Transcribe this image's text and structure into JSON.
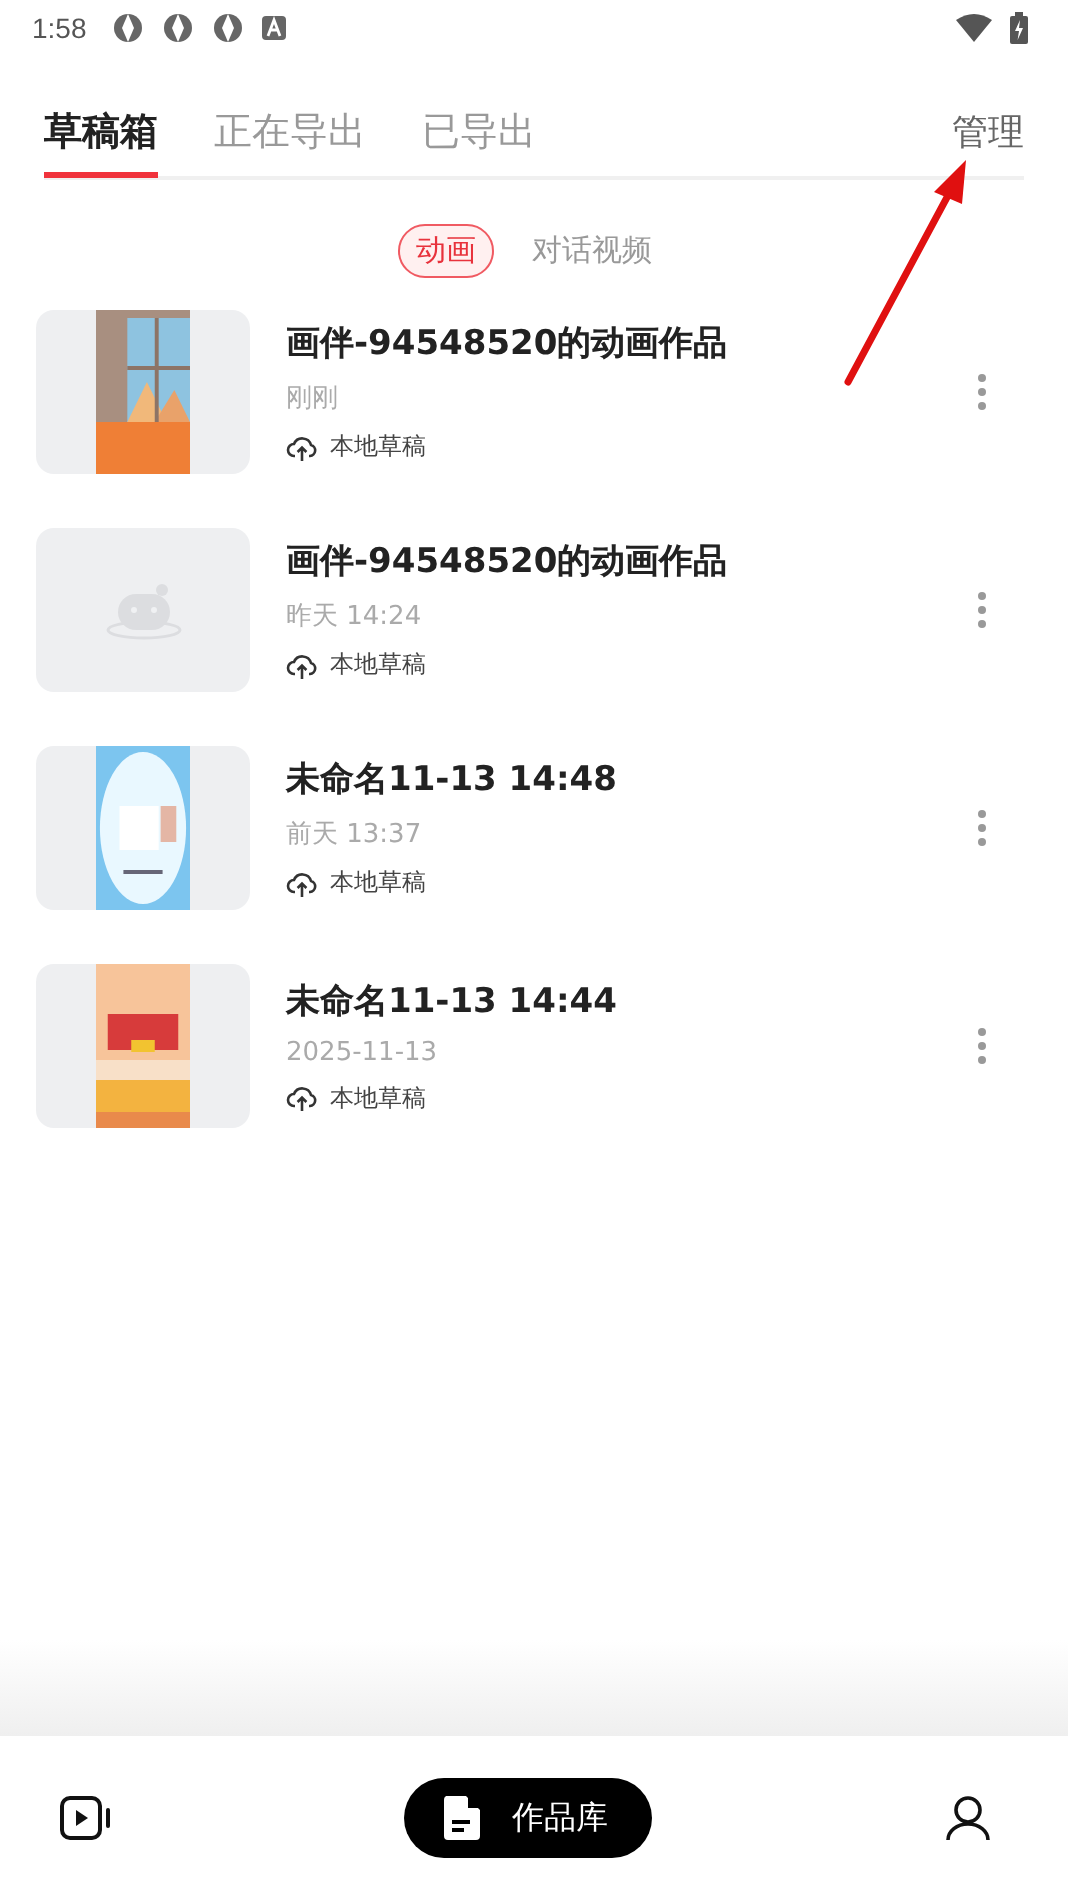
{
  "status_bar": {
    "time": "1:58"
  },
  "tabs": [
    {
      "label": "草稿箱",
      "selected": true
    },
    {
      "label": "正在导出",
      "selected": false
    },
    {
      "label": "已导出",
      "selected": false
    }
  ],
  "manage_button": "管理",
  "filters": [
    {
      "label": "动画",
      "selected": true
    },
    {
      "label": "对话视频",
      "selected": false
    }
  ],
  "drafts": [
    {
      "title": "画伴-94548520的动画作品",
      "time": "刚刚",
      "storage": "本地草稿"
    },
    {
      "title": "画伴-94548520的动画作品",
      "time": "昨天 14:24",
      "storage": "本地草稿",
      "thumb": {
        "kind": "placeholder"
      }
    },
    {
      "title": "未命名11-13 14:48",
      "time": "前天 13:37",
      "storage": "本地草稿"
    },
    {
      "title": "未命名11-13 14:44",
      "time": "2025-11-13",
      "storage": "本地草稿"
    }
  ],
  "annotation": {
    "kind": "arrow"
  },
  "bottom_nav": [
    {
      "kind": "icon",
      "selected": false
    },
    {
      "kind": "pill",
      "label": "作品库",
      "selected": true
    },
    {
      "kind": "profile",
      "selected": false
    }
  ]
}
